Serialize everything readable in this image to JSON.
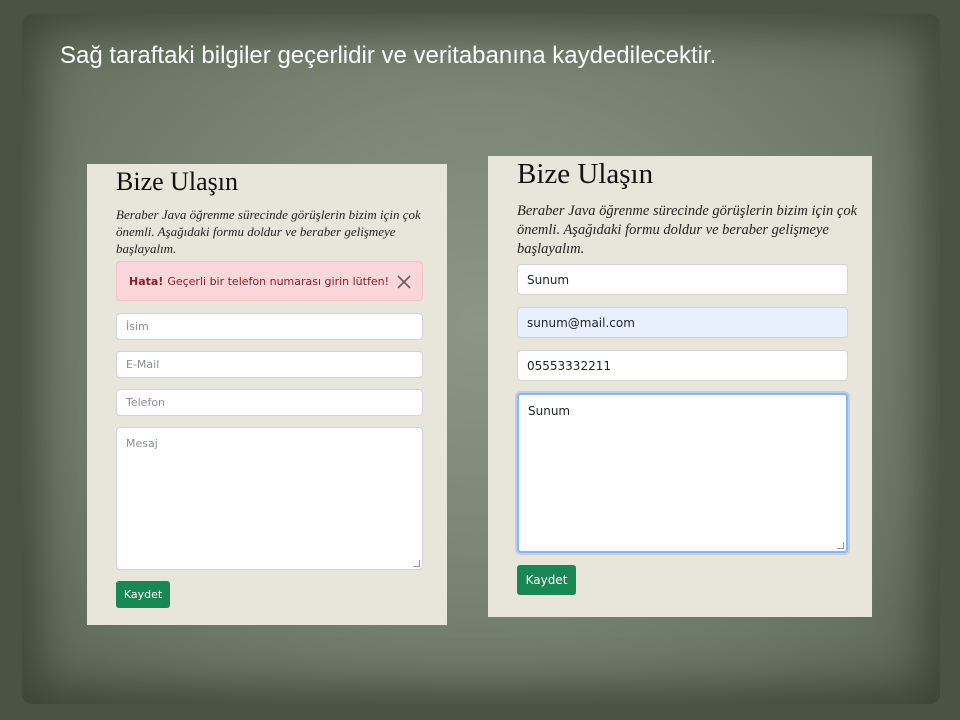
{
  "slide": {
    "title": "Sağ taraftaki bilgiler geçerlidir ve veritabanına kaydedilecektir."
  },
  "left_form": {
    "title": "Bize Ulaşın",
    "description": "Beraber Java öğrenme sürecinde görüşlerin bizim için çok önemli. Aşağıdaki formu doldur ve beraber gelişmeye başlayalım.",
    "alert": {
      "strong": "Hata!",
      "message": "Geçerli bir telefon numarası girin lütfen!"
    },
    "name_placeholder": "İsim",
    "email_placeholder": "E-Mail",
    "phone_placeholder": "Telefon",
    "message_placeholder": "Mesaj",
    "save_label": "Kaydet"
  },
  "right_form": {
    "title": "Bize Ulaşın",
    "description": "Beraber Java öğrenme sürecinde görüşlerin bizim için çok önemli. Aşağıdaki formu doldur ve beraber gelişmeye başlayalım.",
    "name_value": "Sunum",
    "email_value": "sunum@mail.com",
    "phone_value": "05553332211",
    "message_value": "Sunum",
    "save_label": "Kaydet"
  },
  "colors": {
    "button": "#198754",
    "alert_bg": "#f8d7da",
    "alert_text": "#842029",
    "autofill_bg": "#e8f0fe",
    "panel_bg": "#e8e6da"
  }
}
